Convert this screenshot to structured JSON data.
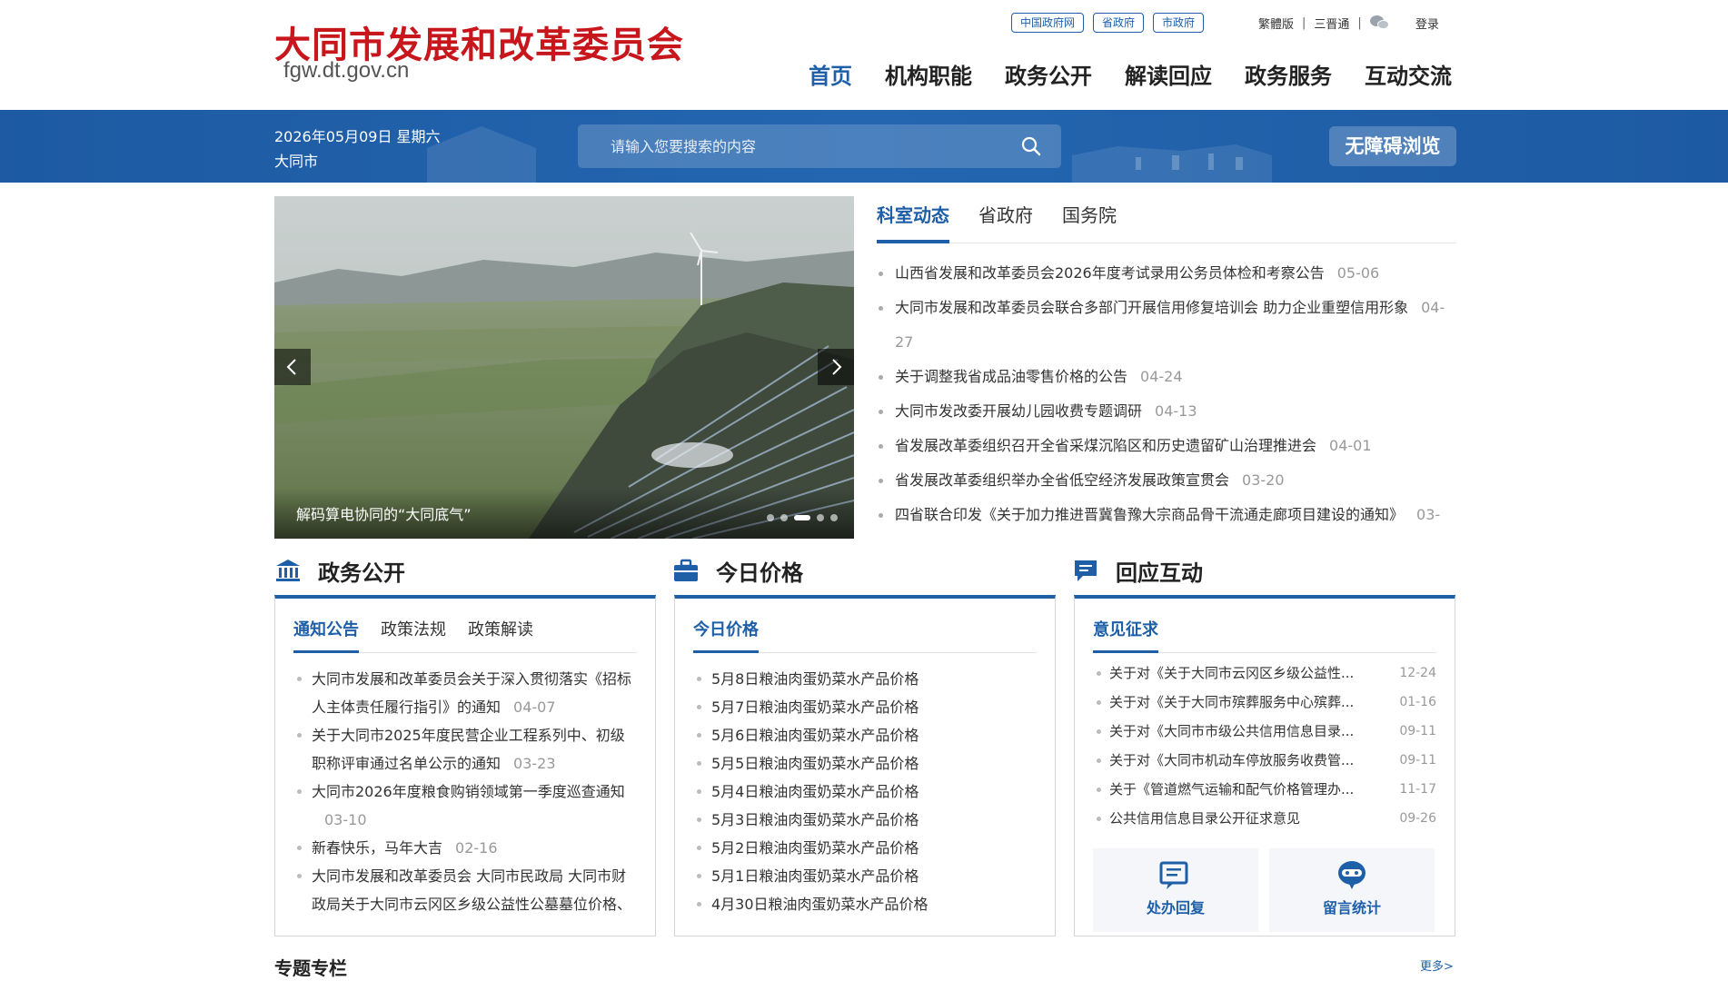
{
  "header": {
    "title": "大同市发展和改革委员会",
    "domain": "fgw.dt.gov.cn",
    "gov_links": [
      "中国政府网",
      "省政府",
      "市政府"
    ],
    "util_links": [
      "繁體版",
      "三晋通"
    ],
    "login": "登录",
    "nav": [
      "首页",
      "机构职能",
      "政务公开",
      "解读回应",
      "政务服务",
      "互动交流"
    ]
  },
  "bar": {
    "date": "2026年05月09日 星期六",
    "city": "大同市",
    "search_placeholder": "请输入您要搜索的内容",
    "accessibility": "无障碍浏览"
  },
  "carousel": {
    "caption": "解码算电协同的“大同底气”",
    "slides": 5,
    "active_slide": 3
  },
  "news": {
    "tabs": [
      "科室动态",
      "省政府",
      "国务院"
    ],
    "items": [
      {
        "title": "山西省发展和改革委员会2026年度考试录用公务员体检和考察公告",
        "date": "05-06"
      },
      {
        "title": "大同市发展和改革委员会联合多部门开展信用修复培训会 助力企业重塑信用形象",
        "date": "04-27"
      },
      {
        "title": "关于调整我省成品油零售价格的公告",
        "date": "04-24"
      },
      {
        "title": "大同市发改委开展幼儿园收费专题调研",
        "date": "04-13"
      },
      {
        "title": "省发展改革委组织召开全省采煤沉陷区和历史遗留矿山治理推进会",
        "date": "04-01"
      },
      {
        "title": "省发展改革委组织举办全省低空经济发展政策宣贯会",
        "date": "03-20"
      },
      {
        "title": "四省联合印发《关于加力推进晋冀鲁豫大宗商品骨干流通走廊项目建设的通知》",
        "date": "03-"
      }
    ]
  },
  "affairs": {
    "title": "政务公开",
    "tabs": [
      "通知公告",
      "政策法规",
      "政策解读"
    ],
    "items": [
      {
        "title": "大同市发展和改革委员会关于深入贯彻落实《招标人主体责任履行指引》的通知",
        "date": "04-07"
      },
      {
        "title": "关于大同市2025年度民营企业工程系列中、初级职称评审通过名单公示的通知",
        "date": "03-23"
      },
      {
        "title": "大同市2026年度粮食购销领域第一季度巡查通知",
        "date": "03-10"
      },
      {
        "title": "新春快乐，马年大吉",
        "date": "02-16"
      },
      {
        "title": "大同市发展和改革委员会 大同市民政局 大同市财政局关于大同市云冈区乡级公益性公墓墓位价格、",
        "date": ""
      }
    ]
  },
  "prices": {
    "title": "今日价格",
    "tab": "今日价格",
    "items": [
      "5月8日粮油肉蛋奶菜水产品价格",
      "5月7日粮油肉蛋奶菜水产品价格",
      "5月6日粮油肉蛋奶菜水产品价格",
      "5月5日粮油肉蛋奶菜水产品价格",
      "5月4日粮油肉蛋奶菜水产品价格",
      "5月3日粮油肉蛋奶菜水产品价格",
      "5月2日粮油肉蛋奶菜水产品价格",
      "5月1日粮油肉蛋奶菜水产品价格",
      "4月30日粮油肉蛋奶菜水产品价格"
    ]
  },
  "interact": {
    "title": "回应互动",
    "tab": "意见征求",
    "items": [
      {
        "title": "关于对《关于大同市云冈区乡级公益性...",
        "date": "12-24"
      },
      {
        "title": "关于对《关于大同市殡葬服务中心殡葬...",
        "date": "01-16"
      },
      {
        "title": "关于对《大同市市级公共信用信息目录...",
        "date": "09-11"
      },
      {
        "title": "关于对《大同市机动车停放服务收费管...",
        "date": "09-11"
      },
      {
        "title": "关于《管道燃气运输和配气价格管理办...",
        "date": "11-17"
      },
      {
        "title": "公共信用信息目录公开征求意见",
        "date": "09-26"
      }
    ],
    "buttons": [
      "处办回复",
      "留言统计"
    ]
  },
  "special": {
    "title": "专题专栏",
    "more": "更多>"
  },
  "colors": {
    "brand_red": "#c8161d",
    "brand_blue": "#1e5fa8"
  }
}
